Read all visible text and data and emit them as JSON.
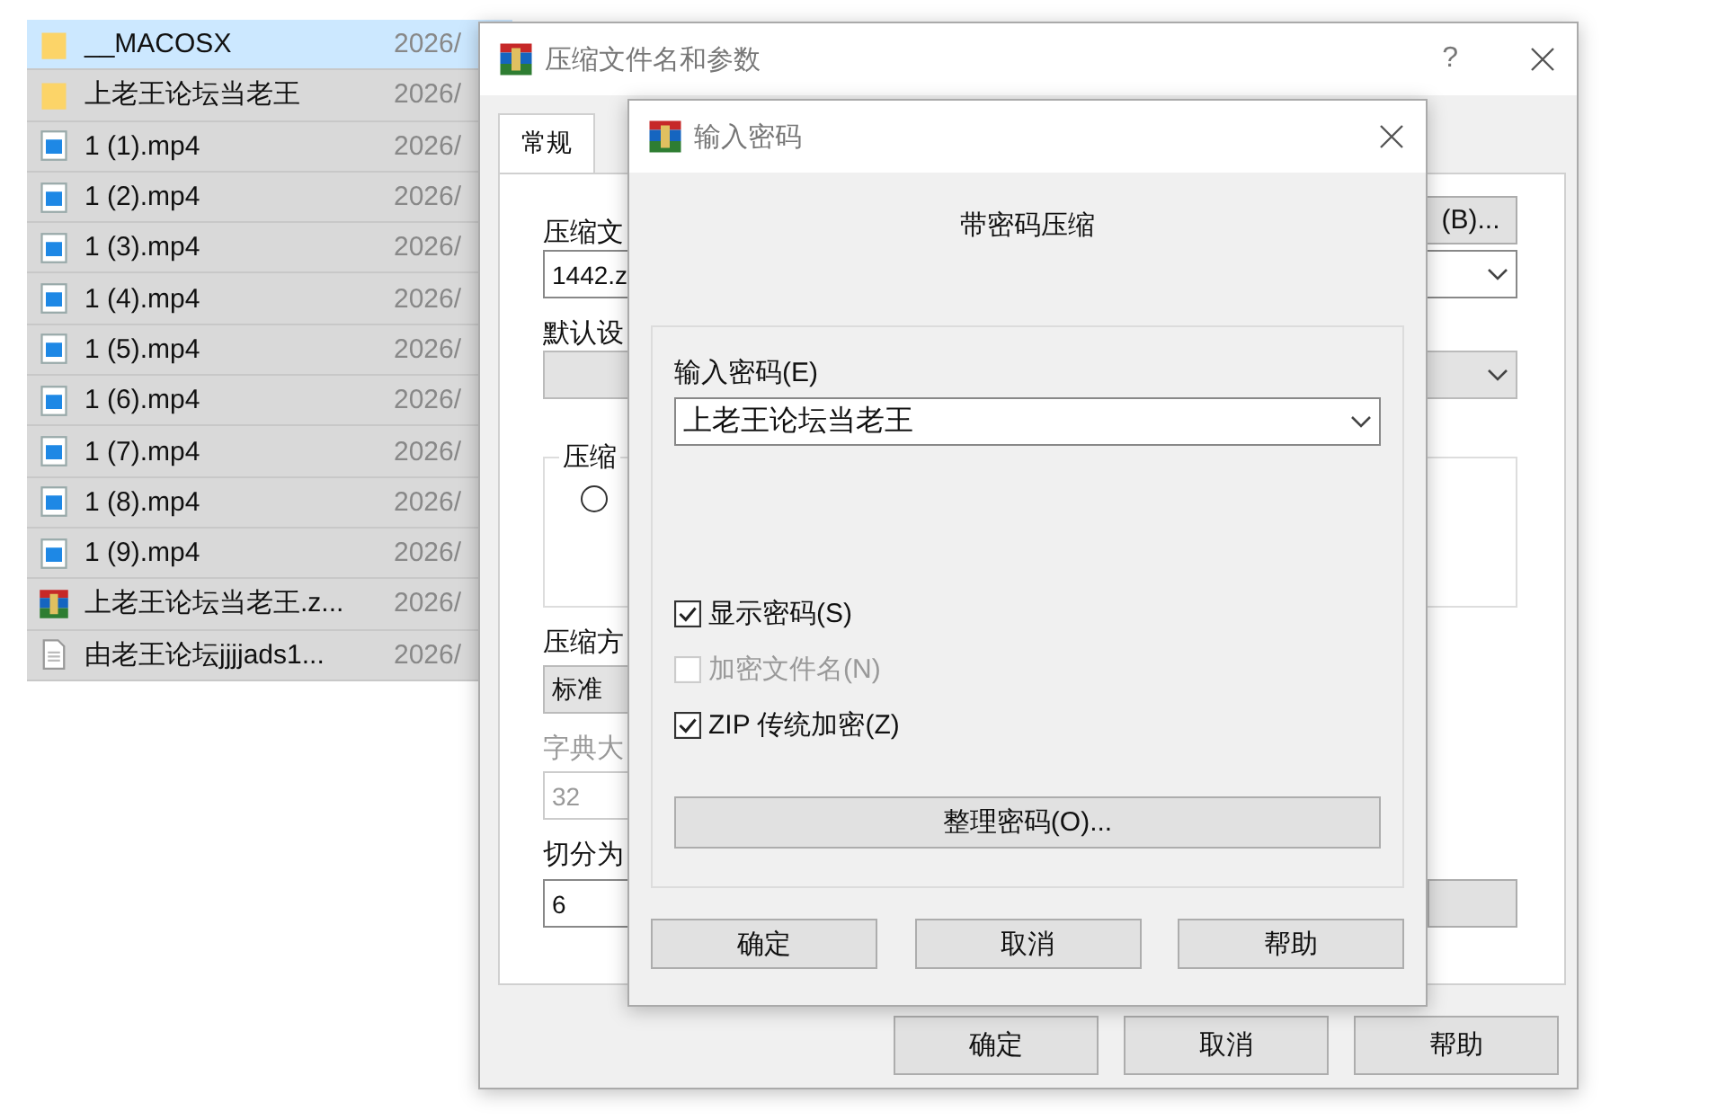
{
  "file_list": [
    {
      "name": "__MACOSX",
      "date": "2026/",
      "kind": "folder",
      "selected": true,
      "focused": true
    },
    {
      "name": "上老王论坛当老王",
      "date": "2026/",
      "kind": "folder",
      "selected": true,
      "focused": false
    },
    {
      "name": "1 (1).mp4",
      "date": "2026/",
      "kind": "video",
      "selected": true,
      "focused": false
    },
    {
      "name": "1 (2).mp4",
      "date": "2026/",
      "kind": "video",
      "selected": true,
      "focused": false
    },
    {
      "name": "1 (3).mp4",
      "date": "2026/",
      "kind": "video",
      "selected": true,
      "focused": false
    },
    {
      "name": "1 (4).mp4",
      "date": "2026/",
      "kind": "video",
      "selected": true,
      "focused": false
    },
    {
      "name": "1 (5).mp4",
      "date": "2026/",
      "kind": "video",
      "selected": true,
      "focused": false
    },
    {
      "name": "1 (6).mp4",
      "date": "2026/",
      "kind": "video",
      "selected": true,
      "focused": false
    },
    {
      "name": "1 (7).mp4",
      "date": "2026/",
      "kind": "video",
      "selected": true,
      "focused": false
    },
    {
      "name": "1 (8).mp4",
      "date": "2026/",
      "kind": "video",
      "selected": true,
      "focused": false
    },
    {
      "name": "1 (9).mp4",
      "date": "2026/",
      "kind": "video",
      "selected": true,
      "focused": false
    },
    {
      "name": "上老王论坛当老王.z...",
      "date": "2026/",
      "kind": "archive",
      "selected": true,
      "focused": false
    },
    {
      "name": "由老王论坛jjjjads1...",
      "date": "2026/",
      "kind": "text",
      "selected": true,
      "focused": false
    }
  ],
  "archive_dialog": {
    "title": "压缩文件名和参数",
    "help": "?",
    "tabs": [
      {
        "label": "常规",
        "selected": true
      }
    ],
    "archive_label": "压缩文",
    "archive_value": "1442.z",
    "browse_button": "(B)...",
    "profile_label": "默认设",
    "group_label": "压缩",
    "radio_checked": false,
    "method_label": "压缩方",
    "method_value": "标准",
    "dict_label": "字典大",
    "dict_value": "32",
    "dict_disabled": true,
    "split_label": "切分为",
    "split_value": "6",
    "buttons": [
      "确定",
      "取消",
      "帮助"
    ]
  },
  "password_dialog": {
    "title": "输入密码",
    "heading": "带密码压缩",
    "password_label": "输入密码(E)",
    "password_value": "上老王论坛当老王",
    "options": [
      {
        "label": "显示密码(S)",
        "checked": true,
        "disabled": false
      },
      {
        "label": "加密文件名(N)",
        "checked": false,
        "disabled": true
      },
      {
        "label": "ZIP 传统加密(Z)",
        "checked": true,
        "disabled": false
      }
    ],
    "organize_button": "整理密码(O)...",
    "buttons": [
      "确定",
      "取消",
      "帮助"
    ]
  }
}
